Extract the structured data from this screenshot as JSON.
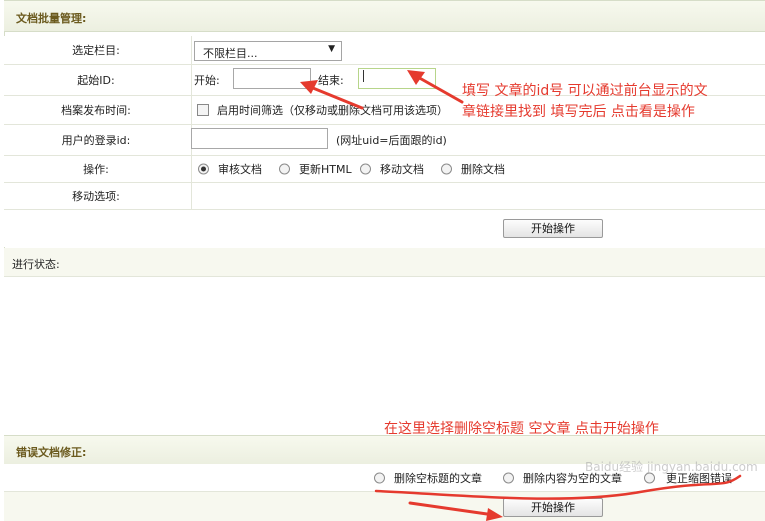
{
  "batch": {
    "title": "文档批量管理:",
    "category_label": "选定栏目:",
    "category_value": "不限栏目...",
    "startid_label": "起始ID:",
    "start_label": "开始:",
    "end_label": "结束:",
    "pubtime_label": "档案发布时间:",
    "pubtime_checkbox": "启用时间筛选（仅移动或删除文档可用该选项）",
    "userid_label": "用户的登录id:",
    "userid_hint": "(网址uid=后面跟的id)",
    "operation_label": "操作:",
    "operations": [
      "审核文档",
      "更新HTML",
      "移动文档",
      "删除文档"
    ],
    "move_label": "移动选项:",
    "start_button": "开始操作"
  },
  "status": {
    "label": "进行状态:"
  },
  "errors": {
    "title": "错误文档修正:",
    "options": [
      "删除空标题的文章",
      "删除内容为空的文章",
      "更正缩图错误"
    ],
    "start_button": "开始操作"
  },
  "annotations": {
    "line1": "填写 文章的id号  可以通过前台显示的文",
    "line2": "章链接里找到    填写完后 点击看是操作",
    "line3": "在这里选择删除空标题  空文章 点击开始操作",
    "color": "#e53a2e"
  },
  "watermark": "Baidu经验 jingyan.baidu.com"
}
